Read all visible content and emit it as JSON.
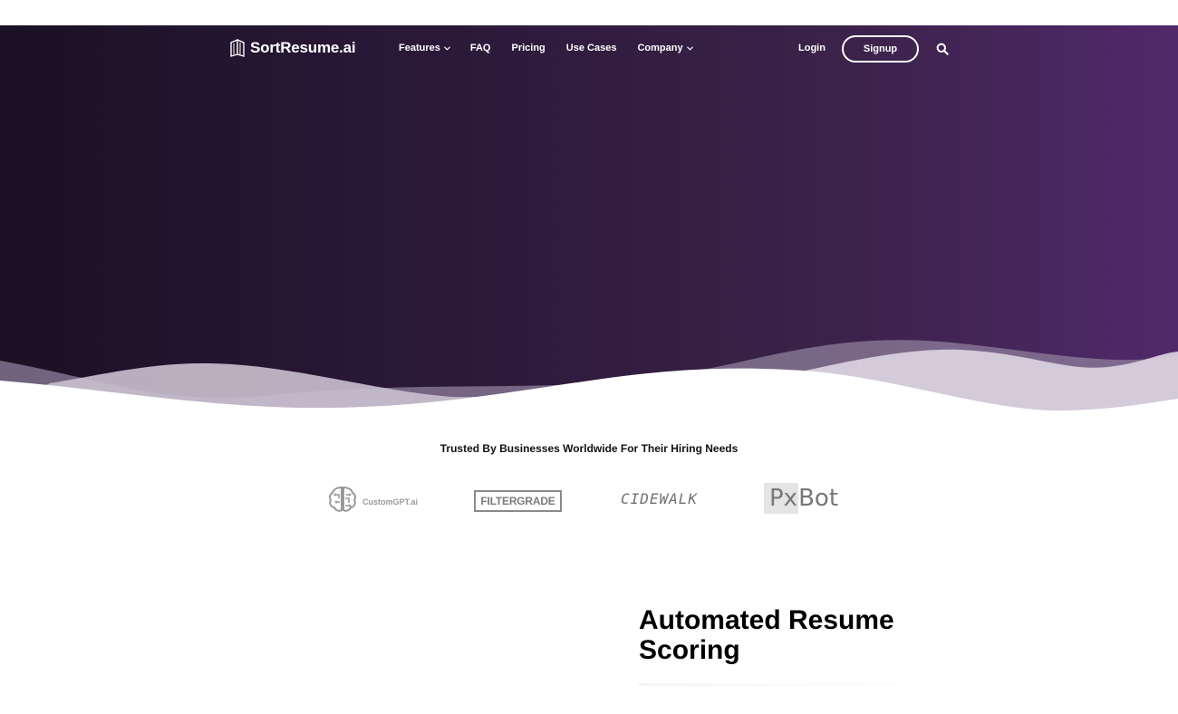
{
  "navbar": {
    "logo_text": "SortResume.ai",
    "links": [
      {
        "label": "Features",
        "has_dropdown": true
      },
      {
        "label": "FAQ",
        "has_dropdown": false
      },
      {
        "label": "Pricing",
        "has_dropdown": false
      },
      {
        "label": "Use Cases",
        "has_dropdown": false
      },
      {
        "label": "Company",
        "has_dropdown": true
      }
    ],
    "login_label": "Login",
    "signup_label": "Signup",
    "search_icon": "search-icon"
  },
  "trusted": {
    "heading": "Trusted By Businesses Worldwide For Their Hiring Needs",
    "brands": [
      {
        "name": "CustomGPT.ai",
        "icon": "brain-icon"
      },
      {
        "name": "FILTERGRADE"
      },
      {
        "name": "CIDEWALK"
      },
      {
        "name_px": "Px",
        "name_bot": "Bot"
      }
    ]
  },
  "feature": {
    "title_line1": "Automated Resume",
    "title_line2": "Scoring"
  },
  "colors": {
    "hero_start": "#1a1124",
    "hero_end": "#51296a",
    "text_light": "#ffffff",
    "text_dark": "#000000"
  }
}
